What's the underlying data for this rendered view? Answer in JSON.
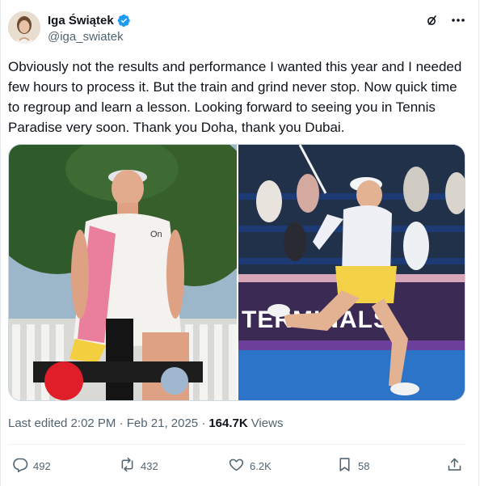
{
  "author": {
    "display_name": "Iga Świątek",
    "handle": "@iga_swiatek"
  },
  "tweet": {
    "text": "Obviously not the results and performance I wanted this year and I needed few hours to process it. But the train and grind never stop. Now quick time to regroup and learn a lesson. Looking forward to seeing you in Tennis Paradise very soon. Thank you Doha, thank you Dubai."
  },
  "media": {
    "photo_left_overlay": "On",
    "photo_right_banner": "TERMINALS"
  },
  "meta": {
    "last_edited": "Last edited 2:02 PM · Feb 21, 2025 ·",
    "views_count": "164.7K",
    "views_label": "Views"
  },
  "actions": {
    "replies": "492",
    "reposts": "432",
    "likes": "6.2K",
    "bookmarks": "58"
  },
  "icons": {
    "verified": "verified-badge-icon",
    "grok": "grok-icon",
    "more": "more-icon",
    "reply": "reply-icon",
    "repost": "repost-icon",
    "like": "like-icon",
    "bookmark": "bookmark-icon",
    "share": "share-icon"
  },
  "colors": {
    "verified": "#1d9bf0",
    "text": "#0f1419",
    "secondary": "#536471"
  }
}
